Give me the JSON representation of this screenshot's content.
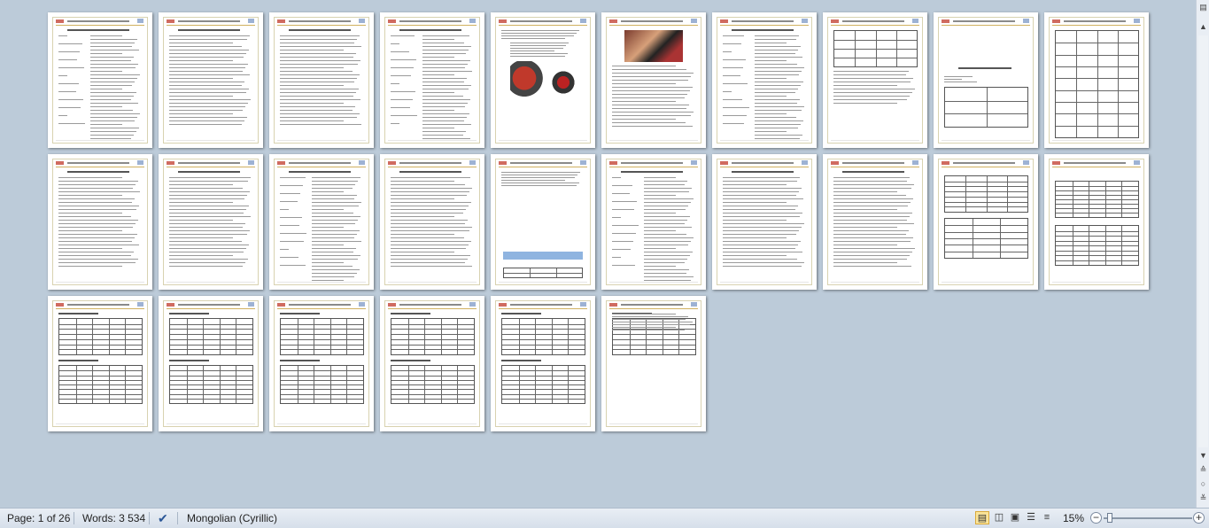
{
  "statusbar": {
    "page_label": "Page: 1 of 26",
    "words_label": "Words: 3 534",
    "language": "Mongolian (Cyrillic)",
    "zoom_label": "15%",
    "proofing_icon": "proofing-check-icon",
    "view_buttons": [
      "print-layout-icon",
      "full-screen-reading-icon",
      "web-layout-icon",
      "outline-icon",
      "draft-icon"
    ],
    "zoom_out_icon": "minus-icon",
    "zoom_in_icon": "plus-icon"
  },
  "scrollbar": {
    "up_icon": "arrow-up-icon",
    "down_icon": "arrow-down-icon",
    "prev_page_icon": "double-up-icon",
    "browse_object_icon": "circle-icon",
    "next_page_icon": "double-down-icon",
    "ruler_toggle_icon": "ruler-icon"
  },
  "document": {
    "page_count": 26,
    "rows": [
      10,
      10,
      6
    ]
  },
  "colors": {
    "workspace": "#bccbd9",
    "statusbar": "#dfe6ef",
    "active_view": "#fbe59a"
  }
}
